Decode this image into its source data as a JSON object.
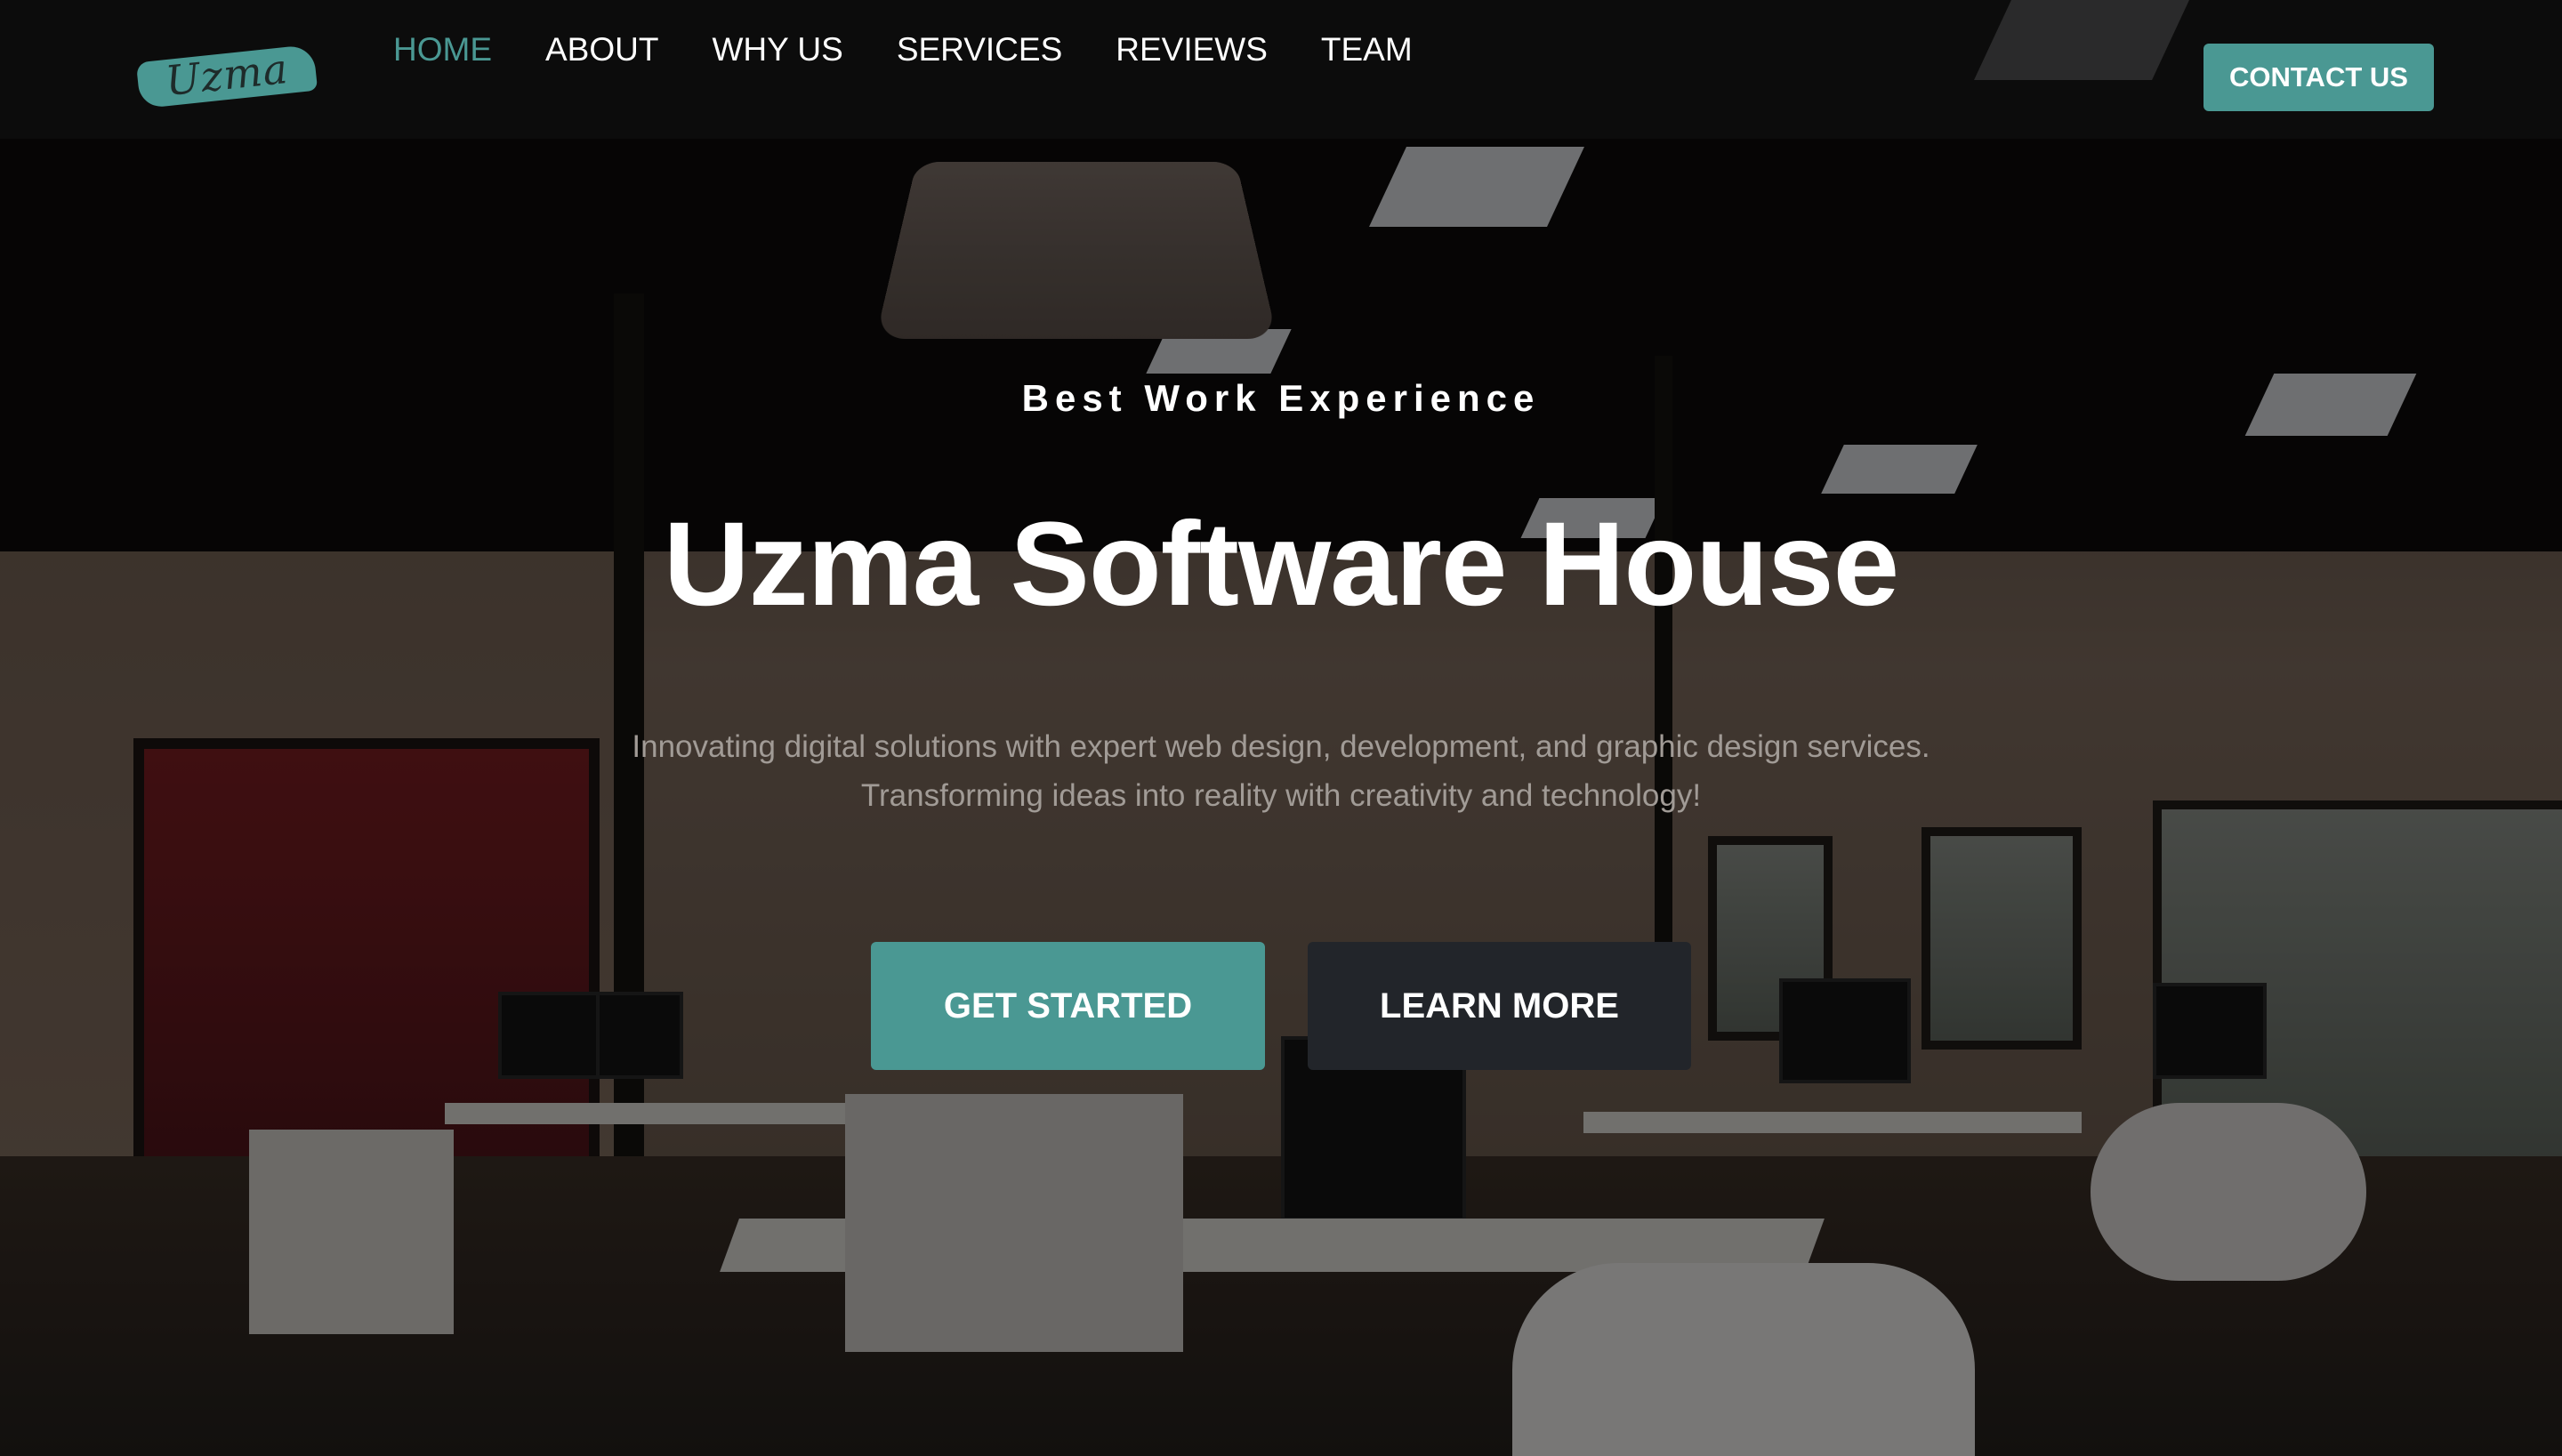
{
  "header": {
    "logo_text": "Uzma",
    "nav": [
      {
        "label": "HOME",
        "active": true
      },
      {
        "label": "ABOUT",
        "active": false
      },
      {
        "label": "WHY US",
        "active": false
      },
      {
        "label": "SERVICES",
        "active": false
      },
      {
        "label": "REVIEWS",
        "active": false
      },
      {
        "label": "TEAM",
        "active": false
      }
    ],
    "contact_label": "CONTACT US"
  },
  "hero": {
    "eyebrow": "Best Work Experience",
    "title": "Uzma Software House",
    "subtitle_line1": "Innovating digital solutions with expert web design, development, and graphic design services.",
    "subtitle_line2": "Transforming ideas into reality with creativity and technology!",
    "primary_cta": "GET STARTED",
    "secondary_cta": "LEARN MORE"
  },
  "colors": {
    "accent": "#4a9893",
    "dark_button": "#22252a",
    "header_bg": "#0f0f0f",
    "text_white": "#ffffff",
    "subtitle": "#a19b96"
  },
  "icons": {
    "logo": "brush-stroke-logo"
  }
}
